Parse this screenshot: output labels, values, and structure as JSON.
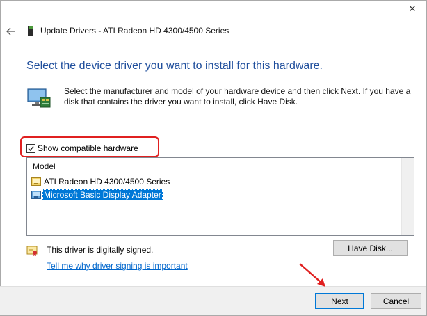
{
  "window": {
    "close_glyph": "✕",
    "title": "Update Drivers - ATI Radeon HD 4300/4500 Series"
  },
  "header": {
    "heading": "Select the device driver you want to install for this hardware.",
    "instructions": "Select the manufacturer and model of your hardware device and then click Next. If you have a disk that contains the driver you want to install, click Have Disk."
  },
  "compat": {
    "label": "Show compatible hardware",
    "checked": true
  },
  "model_list": {
    "header": "Model",
    "items": [
      {
        "label": "ATI Radeon HD 4300/4500 Series",
        "selected": false
      },
      {
        "label": "Microsoft Basic Display Adapter",
        "selected": true
      }
    ]
  },
  "signature": {
    "text": "This driver is digitally signed.",
    "link": "Tell me why driver signing is important"
  },
  "buttons": {
    "have_disk": "Have Disk...",
    "next": "Next",
    "cancel": "Cancel"
  },
  "colors": {
    "heading": "#1f4e9c",
    "selection": "#0078d7",
    "annotation": "#e02020",
    "link": "#0066cc"
  },
  "icons": {
    "back": "back-arrow-icon",
    "device": "display-adapter-icon",
    "hardware": "monitor-hardware-icon",
    "driver": "driver-package-icon",
    "signature": "certificate-icon",
    "annotation_arrow": "red-arrow-icon"
  }
}
